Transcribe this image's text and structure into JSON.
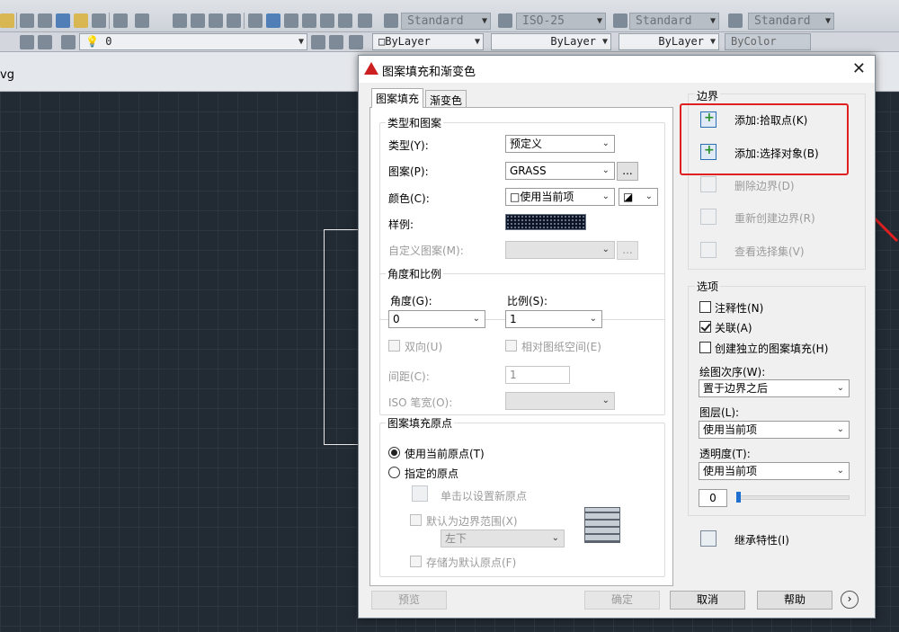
{
  "toolbar_top": {
    "text_style": "Standard",
    "dim_style": "ISO-25",
    "table_style": "Standard",
    "mleader_style": "Standard"
  },
  "toolbar_props": {
    "layer_value": "0",
    "color": "ByLayer",
    "linetype": "ByLayer",
    "lineweight": "ByLayer",
    "plotstyle": "ByColor"
  },
  "file_tab": {
    "name": "vg"
  },
  "dialog": {
    "title": "图案填充和渐变色",
    "tabs": [
      "图案填充",
      "渐变色"
    ],
    "type_pattern": {
      "group_label": "类型和图案",
      "type_label": "类型(Y):",
      "type_value": "预定义",
      "pattern_label": "图案(P):",
      "pattern_value": "GRASS",
      "browse_label": "...",
      "color_label": "颜色(C):",
      "color_value": "使用当前项",
      "sample_label": "样例:",
      "custom_label": "自定义图案(M):",
      "custom_browse": "..."
    },
    "angle_scale": {
      "group_label": "角度和比例",
      "angle_label": "角度(G):",
      "angle_value": "0",
      "scale_label": "比例(S):",
      "scale_value": "1",
      "double_label": "双向(U)",
      "relative_label": "相对图纸空间(E)",
      "spacing_label": "间距(C):",
      "spacing_value": "1",
      "iso_label": "ISO 笔宽(O):"
    },
    "origin": {
      "group_label": "图案填充原点",
      "use_current_label": "使用当前原点(T)",
      "specified_label": "指定的原点",
      "click_set_label": "单击以设置新原点",
      "default_extent_label": "默认为边界范围(X)",
      "extent_value": "左下",
      "store_default_label": "存储为默认原点(F)"
    },
    "boundary": {
      "group_label": "边界",
      "add_pick_label": "添加:拾取点(K)",
      "add_select_label": "添加:选择对象(B)",
      "remove_label": "删除边界(D)",
      "recreate_label": "重新创建边界(R)",
      "view_label": "查看选择集(V)"
    },
    "options": {
      "group_label": "选项",
      "annotative_label": "注释性(N)",
      "associative_label": "关联(A)",
      "independent_label": "创建独立的图案填充(H)",
      "draw_order_label": "绘图次序(W):",
      "draw_order_value": "置于边界之后",
      "layer_label": "图层(L):",
      "layer_value": "使用当前项",
      "transparency_label": "透明度(T):",
      "transparency_value": "使用当前项",
      "transparency_amount": "0"
    },
    "inherit_label": "继承特性(I)",
    "footer": {
      "preview": "预览",
      "ok": "确定",
      "cancel": "取消",
      "help": "帮助"
    }
  }
}
